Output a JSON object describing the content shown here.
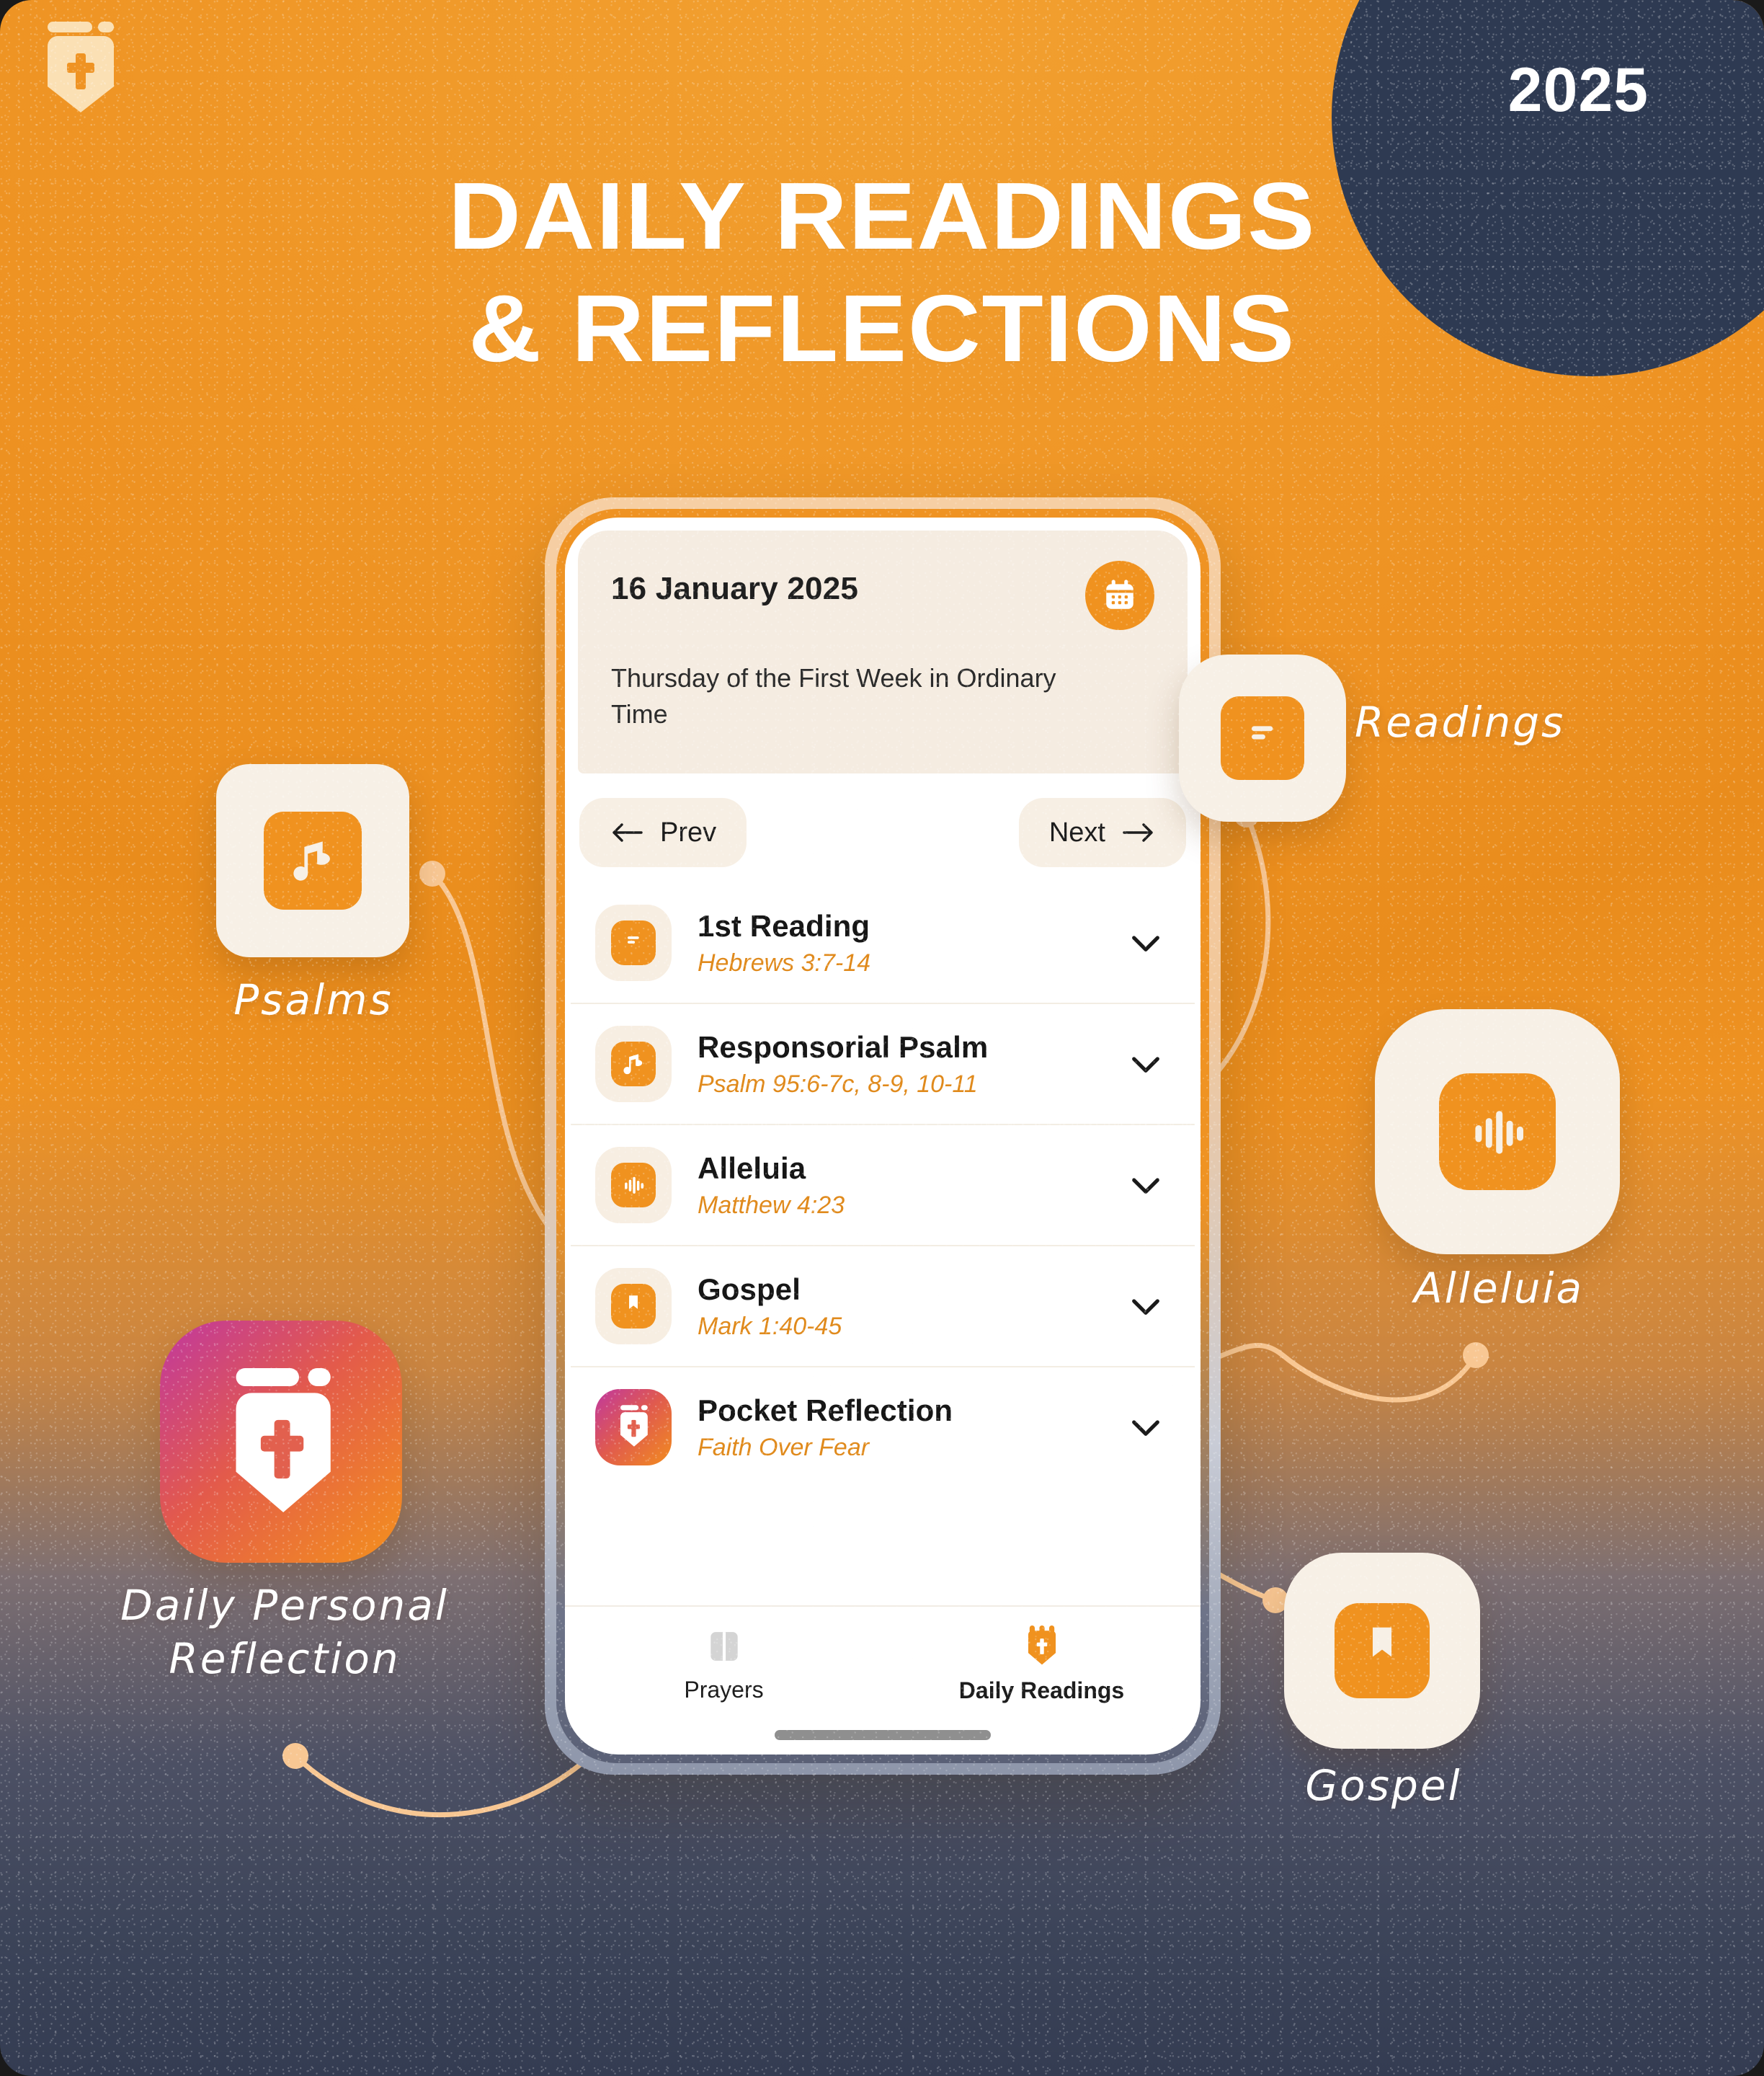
{
  "poster": {
    "year_badge": "2025",
    "title_line1": "DAILY READINGS",
    "title_line2": "& REFLECTIONS",
    "logo_icon": "shield-cross-icon",
    "colors": {
      "brand_orange": "#ef9323",
      "accent_orange": "#f0921f",
      "navy": "#2e3a52",
      "cream": "#f5ece1",
      "reference_orange": "#e08a1c"
    }
  },
  "phone": {
    "date_card": {
      "date": "16 January 2025",
      "liturgy": "Thursday of the First Week in Ordinary Time",
      "calendar_icon": "calendar-icon"
    },
    "nav": {
      "prev_label": "Prev",
      "next_label": "Next",
      "prev_icon": "arrow-left-icon",
      "next_icon": "arrow-right-icon"
    },
    "readings": [
      {
        "title": "1st Reading",
        "reference": "Hebrews 3:7-14",
        "icon": "document-lines-icon",
        "chevron": "chevron-down-icon",
        "gradient": false
      },
      {
        "title": "Responsorial Psalm",
        "reference": "Psalm 95:6-7c, 8-9, 10-11",
        "icon": "music-note-icon",
        "chevron": "chevron-down-icon",
        "gradient": false
      },
      {
        "title": "Alleluia",
        "reference": "Matthew 4:23",
        "icon": "waveform-icon",
        "chevron": "chevron-down-icon",
        "gradient": false
      },
      {
        "title": "Gospel",
        "reference": "Mark 1:40-45",
        "icon": "bookmark-book-icon",
        "chevron": "chevron-down-icon",
        "gradient": false
      },
      {
        "title": "Pocket Reflection",
        "reference": "Faith Over Fear",
        "icon": "shield-cross-icon",
        "chevron": "chevron-down-icon",
        "gradient": true
      }
    ],
    "tabs": [
      {
        "label": "Prayers",
        "icon": "open-book-icon",
        "active": false
      },
      {
        "label": "Daily Readings",
        "icon": "shield-cross-icon",
        "active": true
      }
    ]
  },
  "callouts": [
    {
      "label": "Psalms",
      "icon": "music-note-icon",
      "side": "left"
    },
    {
      "label": "Daily Personal\nReflection",
      "icon": "shield-cross-icon",
      "side": "left"
    },
    {
      "label": "Readings",
      "icon": "document-lines-icon",
      "side": "right"
    },
    {
      "label": "Alleluia",
      "icon": "waveform-icon",
      "side": "right"
    },
    {
      "label": "Gospel",
      "icon": "bookmark-book-icon",
      "side": "right"
    }
  ]
}
